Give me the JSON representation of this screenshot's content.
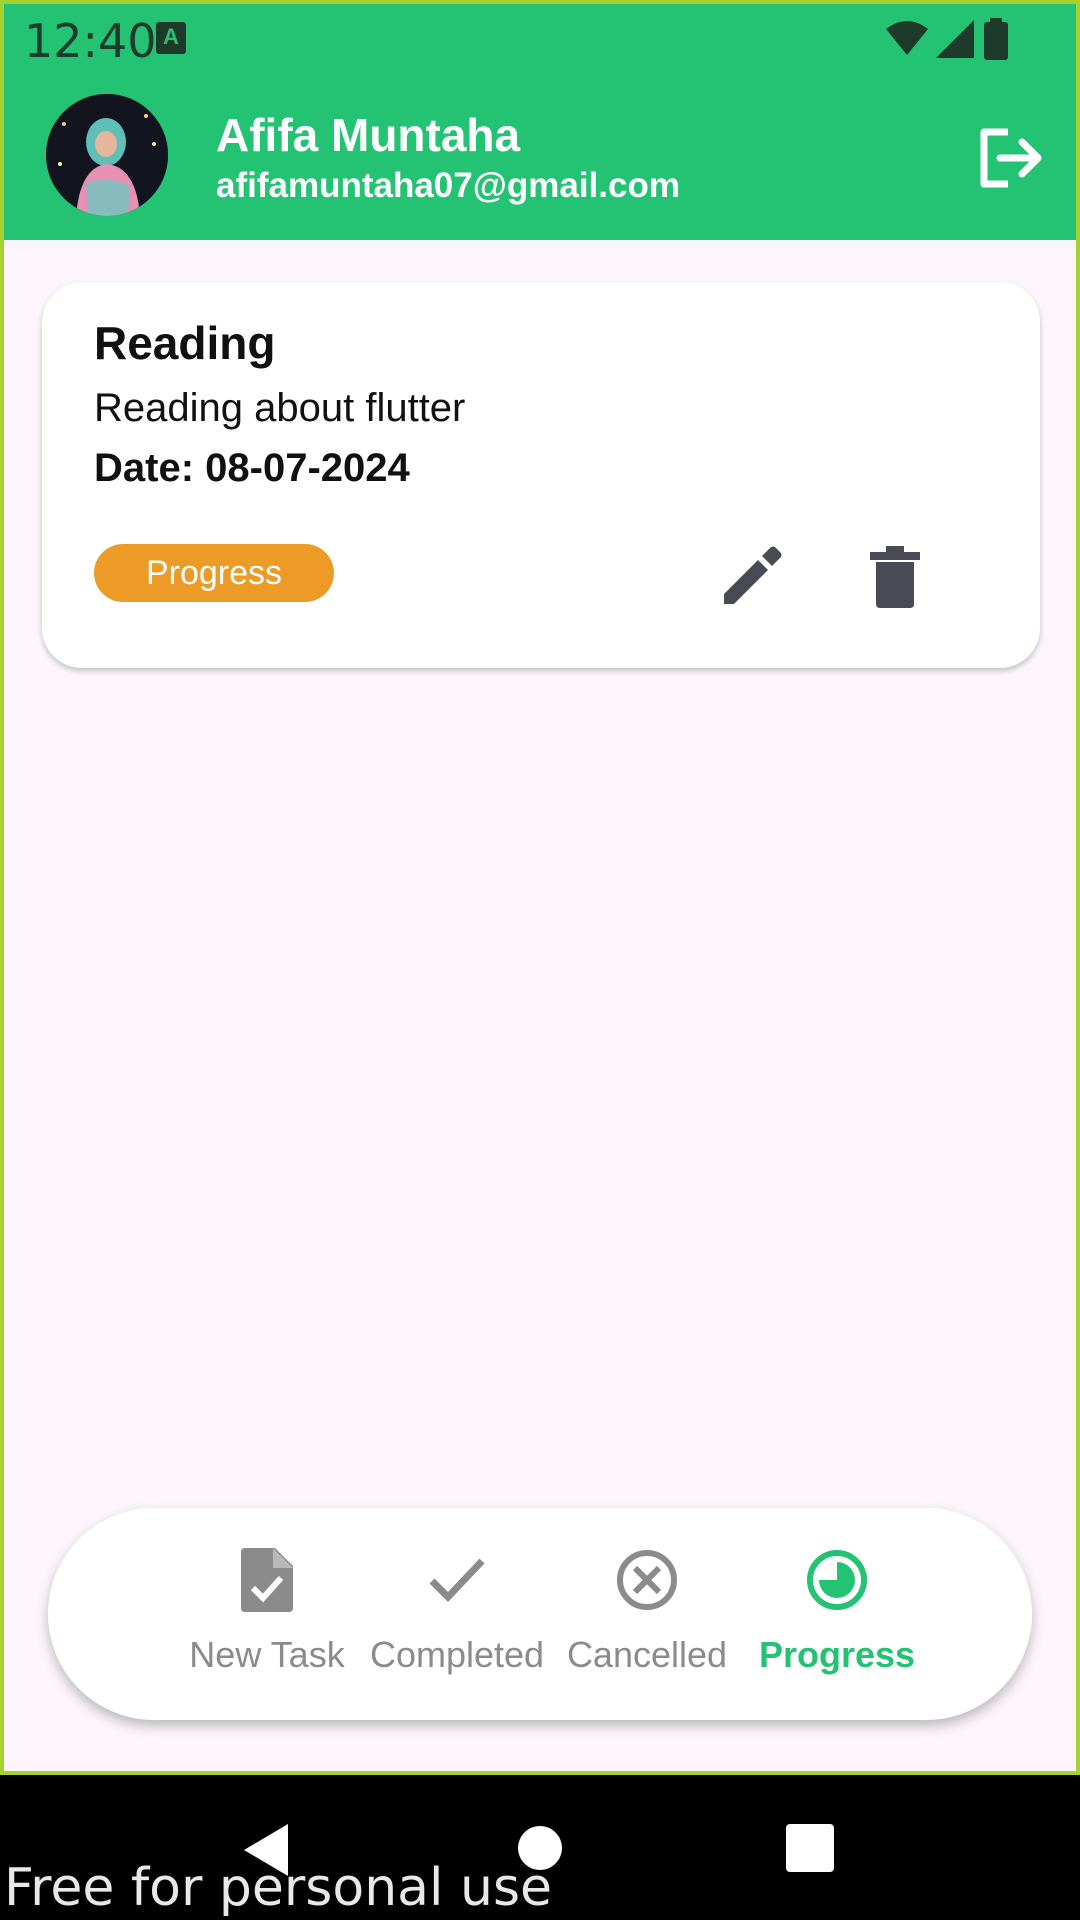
{
  "status_bar": {
    "time": "12:40",
    "notification_icon": "A",
    "icons": [
      "wifi-icon",
      "signal-icon",
      "battery-icon"
    ]
  },
  "profile": {
    "name": "Afifa Muntaha",
    "email": "afifamuntaha07@gmail.com",
    "logout_icon": "logout-icon"
  },
  "tasks": [
    {
      "title": "Reading",
      "description": "Reading about flutter",
      "date": "Date: 08-07-2024",
      "status": "Progress",
      "actions": [
        "edit-icon",
        "delete-icon"
      ]
    }
  ],
  "bottom_nav": {
    "items": [
      {
        "label": "New Task",
        "icon": "new-task-icon"
      },
      {
        "label": "Completed",
        "icon": "check-icon"
      },
      {
        "label": "Cancelled",
        "icon": "cancel-circle-icon"
      },
      {
        "label": "Progress",
        "icon": "progress-icon"
      }
    ],
    "active": "Progress"
  },
  "watermark": "Free for personal use",
  "colors": {
    "primary": "#24c273",
    "badge_progress": "#ed9b27",
    "background": "#fcf6fc",
    "icon_dark": "#4a4a55",
    "inactive": "#8b8b8b"
  }
}
